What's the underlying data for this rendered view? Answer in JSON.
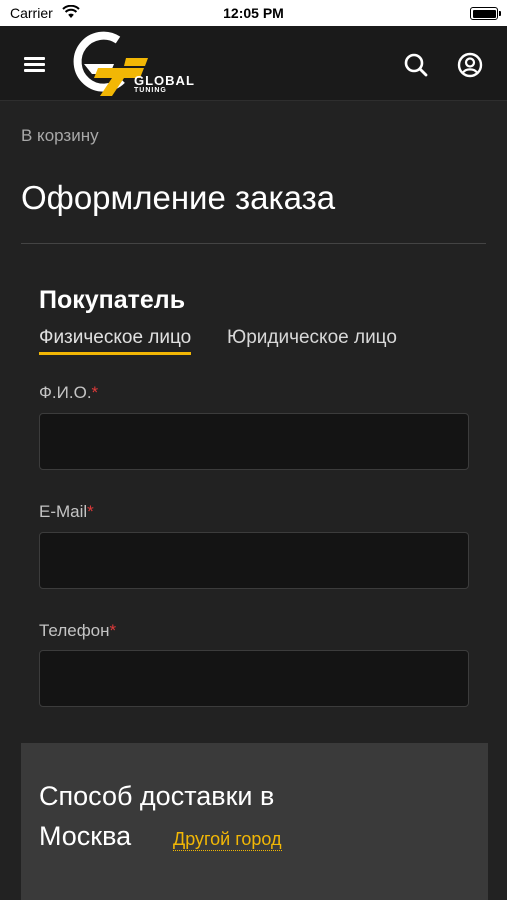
{
  "status_bar": {
    "carrier": "Carrier",
    "time": "12:05 PM"
  },
  "header": {
    "logo_text": "GLOBAL",
    "logo_subtext": "TUNING",
    "accent_color": "#f2b705"
  },
  "back_link": "В корзину",
  "page_title": "Оформление заказа",
  "buyer": {
    "title": "Покупатель",
    "tabs": [
      {
        "label": "Физическое лицо",
        "active": true
      },
      {
        "label": "Юридическое лицо",
        "active": false
      }
    ],
    "fields": [
      {
        "label": "Ф.И.О.",
        "required_mark": "*",
        "value": ""
      },
      {
        "label": "E-Mail",
        "required_mark": "*",
        "value": ""
      },
      {
        "label": "Телефон",
        "required_mark": "*",
        "value": ""
      }
    ]
  },
  "delivery": {
    "title_line1": "Способ доставки в",
    "city": "Москва",
    "other_city_link": "Другой город"
  }
}
